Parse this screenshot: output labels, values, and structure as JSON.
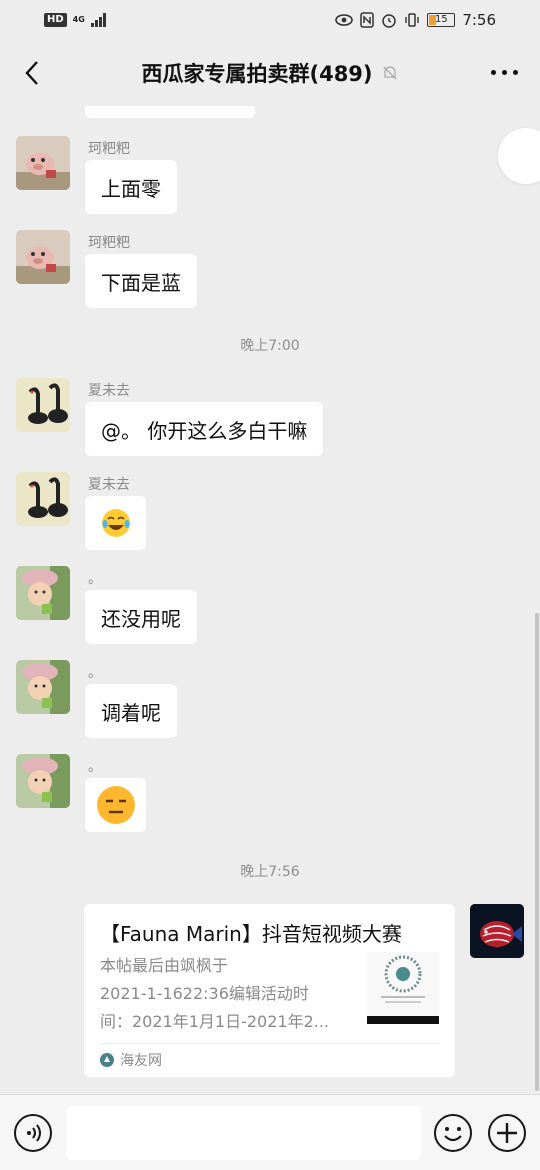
{
  "status_bar": {
    "hd_badge": "HD",
    "network_type": "4G",
    "time": "7:56",
    "battery": "15"
  },
  "header": {
    "title": "西瓜家专属拍卖群(489)"
  },
  "messages": [
    {
      "sender": "珂粑粑",
      "text": "上面零"
    },
    {
      "sender": "珂粑粑",
      "text": "下面是蓝"
    },
    {
      "sender": "夏未去",
      "text": "@。 你开这么多白干嘛"
    },
    {
      "sender": "夏未去",
      "emoji": "face-with-tears-of-joy"
    },
    {
      "sender": "。",
      "text": "还没用呢"
    },
    {
      "sender": "。",
      "text": "调着呢"
    },
    {
      "sender": "。",
      "emoji": "expressionless-face"
    }
  ],
  "timestamps": [
    "晚上7:00",
    "晚上7:56"
  ],
  "link_card": {
    "title": "【Fauna Marin】抖音短视频大赛",
    "desc_lines": [
      "本帖最后由飒枫于",
      "2021-1-1622:36编辑活动时",
      "间：2021年1月1日-2021年2..."
    ],
    "source": "海友网"
  },
  "input": {
    "value": ""
  },
  "colors": {
    "background": "#ededed",
    "bubble": "#ffffff",
    "timestamp_text": "#8e8e8e",
    "sender_text": "#8a8a8a"
  }
}
